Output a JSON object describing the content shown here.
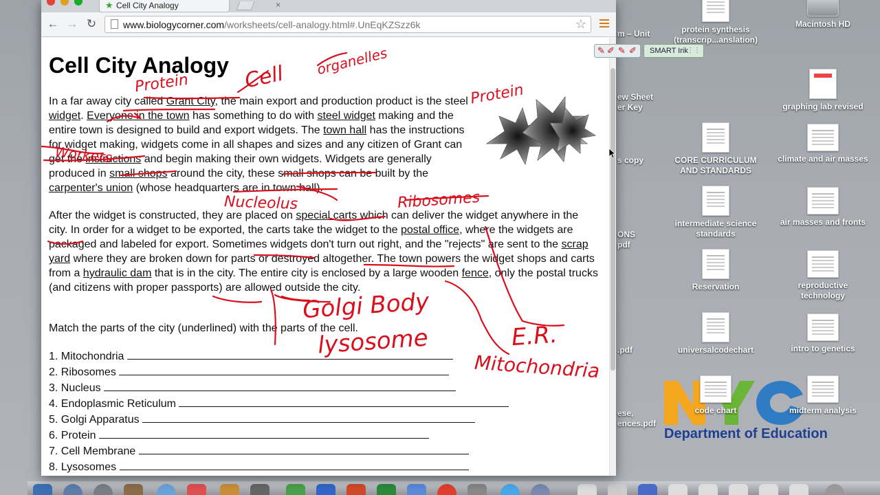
{
  "browser": {
    "tab_title": "Cell City Analogy",
    "tab_close": "×",
    "url_host": "www.biologycorner.com",
    "url_path": "/worksheets/cell-analogy.html#.UnEqKZSzz6k",
    "back_glyph": "←",
    "forward_glyph": "→",
    "reload_glyph": "↻",
    "star_glyph": "☆",
    "favicon_glyph": "★"
  },
  "page": {
    "title": "Cell City Analogy",
    "para1": [
      {
        "t": "In a far away city called "
      },
      {
        "t": "Grant City",
        "u": true
      },
      {
        "t": ", the main export and production product is the steel "
      },
      {
        "t": "widget",
        "u": true
      },
      {
        "t": ". "
      },
      {
        "t": "Everyone in the town",
        "u": true
      },
      {
        "t": " has something to do with "
      },
      {
        "t": "steel widget",
        "u": true
      },
      {
        "t": " making and the entire town is designed to build and export widgets. The "
      },
      {
        "t": "town hall",
        "u": true
      },
      {
        "t": " has the instructions for widget making, widgets come in all shapes and sizes and any citizen of Grant can get the "
      },
      {
        "t": "instructions",
        "u": true
      },
      {
        "t": " and begin making their own widgets. Widgets are generally produced in "
      },
      {
        "t": "small shops",
        "u": true
      },
      {
        "t": " around the city, these small shops can be built by the "
      },
      {
        "t": "carpenter's union",
        "u": true
      },
      {
        "t": " (whose headquarters are in town hall)."
      }
    ],
    "para2": [
      {
        "t": "After the widget is constructed, they are placed on "
      },
      {
        "t": "special carts",
        "u": true
      },
      {
        "t": " which can deliver the widget anywhere in the city. In order for a widget to be exported, the carts take the widget to the "
      },
      {
        "t": "postal office",
        "u": true
      },
      {
        "t": ", where the widgets are packaged and labeled for export. Sometimes widgets don't turn out right, and the \"rejects\" are sent to the "
      },
      {
        "t": "scrap yard",
        "u": true
      },
      {
        "t": " where they are broken down for parts or destroyed altogether. The town powers the widget shops and carts from a "
      },
      {
        "t": "hydraulic dam",
        "u": true
      },
      {
        "t": " that is in the city. The entire city is enclosed by a large wooden "
      },
      {
        "t": "fence",
        "u": true
      },
      {
        "t": ", only the postal trucks (and citizens with proper passports) are allowed outside the city."
      }
    ],
    "para3": "Match the parts of the city (underlined) with the parts of the cell.",
    "match_items": [
      {
        "label": "1. Mitochondria",
        "blank": 474
      },
      {
        "label": "2. Ribosomes",
        "blank": 480
      },
      {
        "label": "3. Nucleus",
        "blank": 512
      },
      {
        "label": "4. Endoplasmic Reticulum",
        "blank": 480
      },
      {
        "label": "5. Golgi Apparatus",
        "blank": 484
      },
      {
        "label": "6. Protein",
        "blank": 480
      },
      {
        "label": "7. Cell Membrane",
        "blank": 480
      },
      {
        "label": "8. Lysosomes",
        "blank": 508
      }
    ],
    "ink_annotations": [
      {
        "text": "Protein",
        "size": 22
      },
      {
        "text": "Cell",
        "size": 30
      },
      {
        "text": "organelles",
        "size": 20
      },
      {
        "text": "Protein",
        "size": 22
      },
      {
        "text": "Workers",
        "size": 20
      },
      {
        "text": "Nucleolus",
        "size": 22
      },
      {
        "text": "Ribosomes",
        "size": 22
      },
      {
        "text": "Golgi Body",
        "size": 34
      },
      {
        "text": "lysosome",
        "size": 34
      },
      {
        "text": "E.R.",
        "size": 34
      },
      {
        "text": "Mitochondria",
        "size": 28
      }
    ]
  },
  "smart_ink": {
    "label": "SMART Ink",
    "grip": "⋮⋮⋮",
    "pens": [
      "✎",
      "✐",
      "✎",
      "✐"
    ]
  },
  "desktop": {
    "icons": [
      {
        "label": "protein synthesis (transcrip...anslation)",
        "type": "doc"
      },
      {
        "label": "Macintosh HD",
        "type": "hd"
      },
      {
        "label": "graphing lab revised",
        "type": "pink"
      },
      {
        "label": "CORE CURRICULUM AND STANDARDS",
        "type": "doc"
      },
      {
        "label": "climate and air masses",
        "type": "landscape"
      },
      {
        "label": "intermediate science standards",
        "type": "doc"
      },
      {
        "label": "air masses and fronts",
        "type": "landscape"
      },
      {
        "label": "Reservation",
        "type": "doc"
      },
      {
        "label": "reproductive technology",
        "type": "landscape"
      },
      {
        "label": "universalcodechart",
        "type": "doc"
      },
      {
        "label": "intro to genetics",
        "type": "landscape"
      },
      {
        "label": "code chart",
        "type": "landscape"
      },
      {
        "label": "midterm analysis",
        "type": "landscape"
      }
    ],
    "partial_labels": [
      "m – Unit",
      "ew Sheet",
      "er Key",
      "s copy",
      "ONS",
      "pdf",
      ".pdf",
      "ese,",
      "ences.pdf"
    ],
    "nyc_department": "Department of Education"
  },
  "colors": {
    "ink": "#d8101e",
    "nyc_orange": "#f4a61c",
    "nyc_green": "#6bb536",
    "nyc_blue": "#2f7cc4",
    "nyc_dept_text": "#1f3f8f"
  }
}
